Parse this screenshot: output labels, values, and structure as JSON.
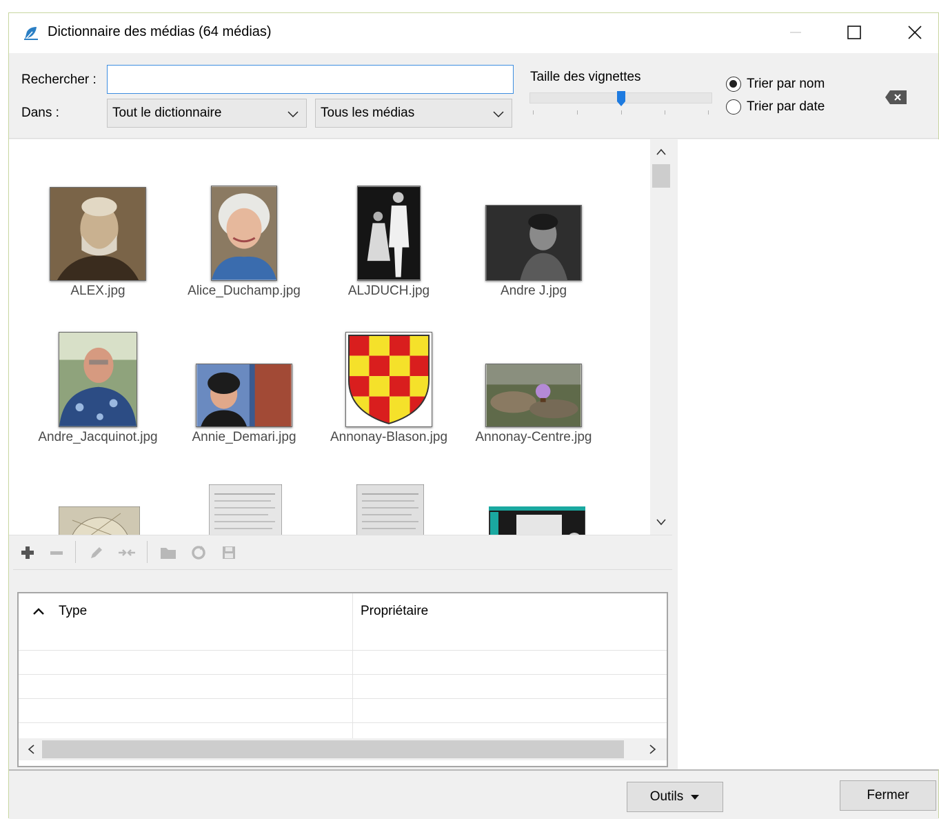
{
  "window": {
    "title": "Dictionnaire des médias (64 médias)",
    "controls": [
      "minimize",
      "maximize",
      "close"
    ]
  },
  "toolbar": {
    "search_label": "Rechercher :",
    "search_value": "",
    "scope_label": "Dans :",
    "scope_selected": "Tout le dictionnaire",
    "media_filter_selected": "Tous les médias",
    "thumbnail_size_label": "Taille des vignettes",
    "thumbnail_size_level": 0.5,
    "sort_by_name_label": "Trier par nom",
    "sort_by_date_label": "Trier par date",
    "sort_selected": "name"
  },
  "gallery": {
    "items": [
      {
        "name": "ALEX.jpg"
      },
      {
        "name": "Alice_Duchamp.jpg"
      },
      {
        "name": "ALJDUCH.jpg"
      },
      {
        "name": "Andre J.jpg"
      },
      {
        "name": "Andre_Jacquinot.jpg"
      },
      {
        "name": "Annie_Demari.jpg"
      },
      {
        "name": "Annonay-Blason.jpg"
      },
      {
        "name": "Annonay-Centre.jpg"
      }
    ]
  },
  "media_toolbar": {
    "icons": [
      "add-icon",
      "remove-icon",
      "edit-icon",
      "merge-icon",
      "folder-icon",
      "refresh-icon",
      "save-icon"
    ]
  },
  "properties_table": {
    "columns": [
      "Type",
      "Propriétaire"
    ],
    "sort_column": "Type",
    "sort_direction": "ascending",
    "rows": []
  },
  "footer": {
    "tools_label": "Outils",
    "close_label": "Fermer"
  },
  "colors": {
    "accent": "#3c8de0",
    "slider_thumb": "#1e7be0",
    "blason_red": "#d91e1e",
    "blason_yellow": "#f5e12a"
  }
}
